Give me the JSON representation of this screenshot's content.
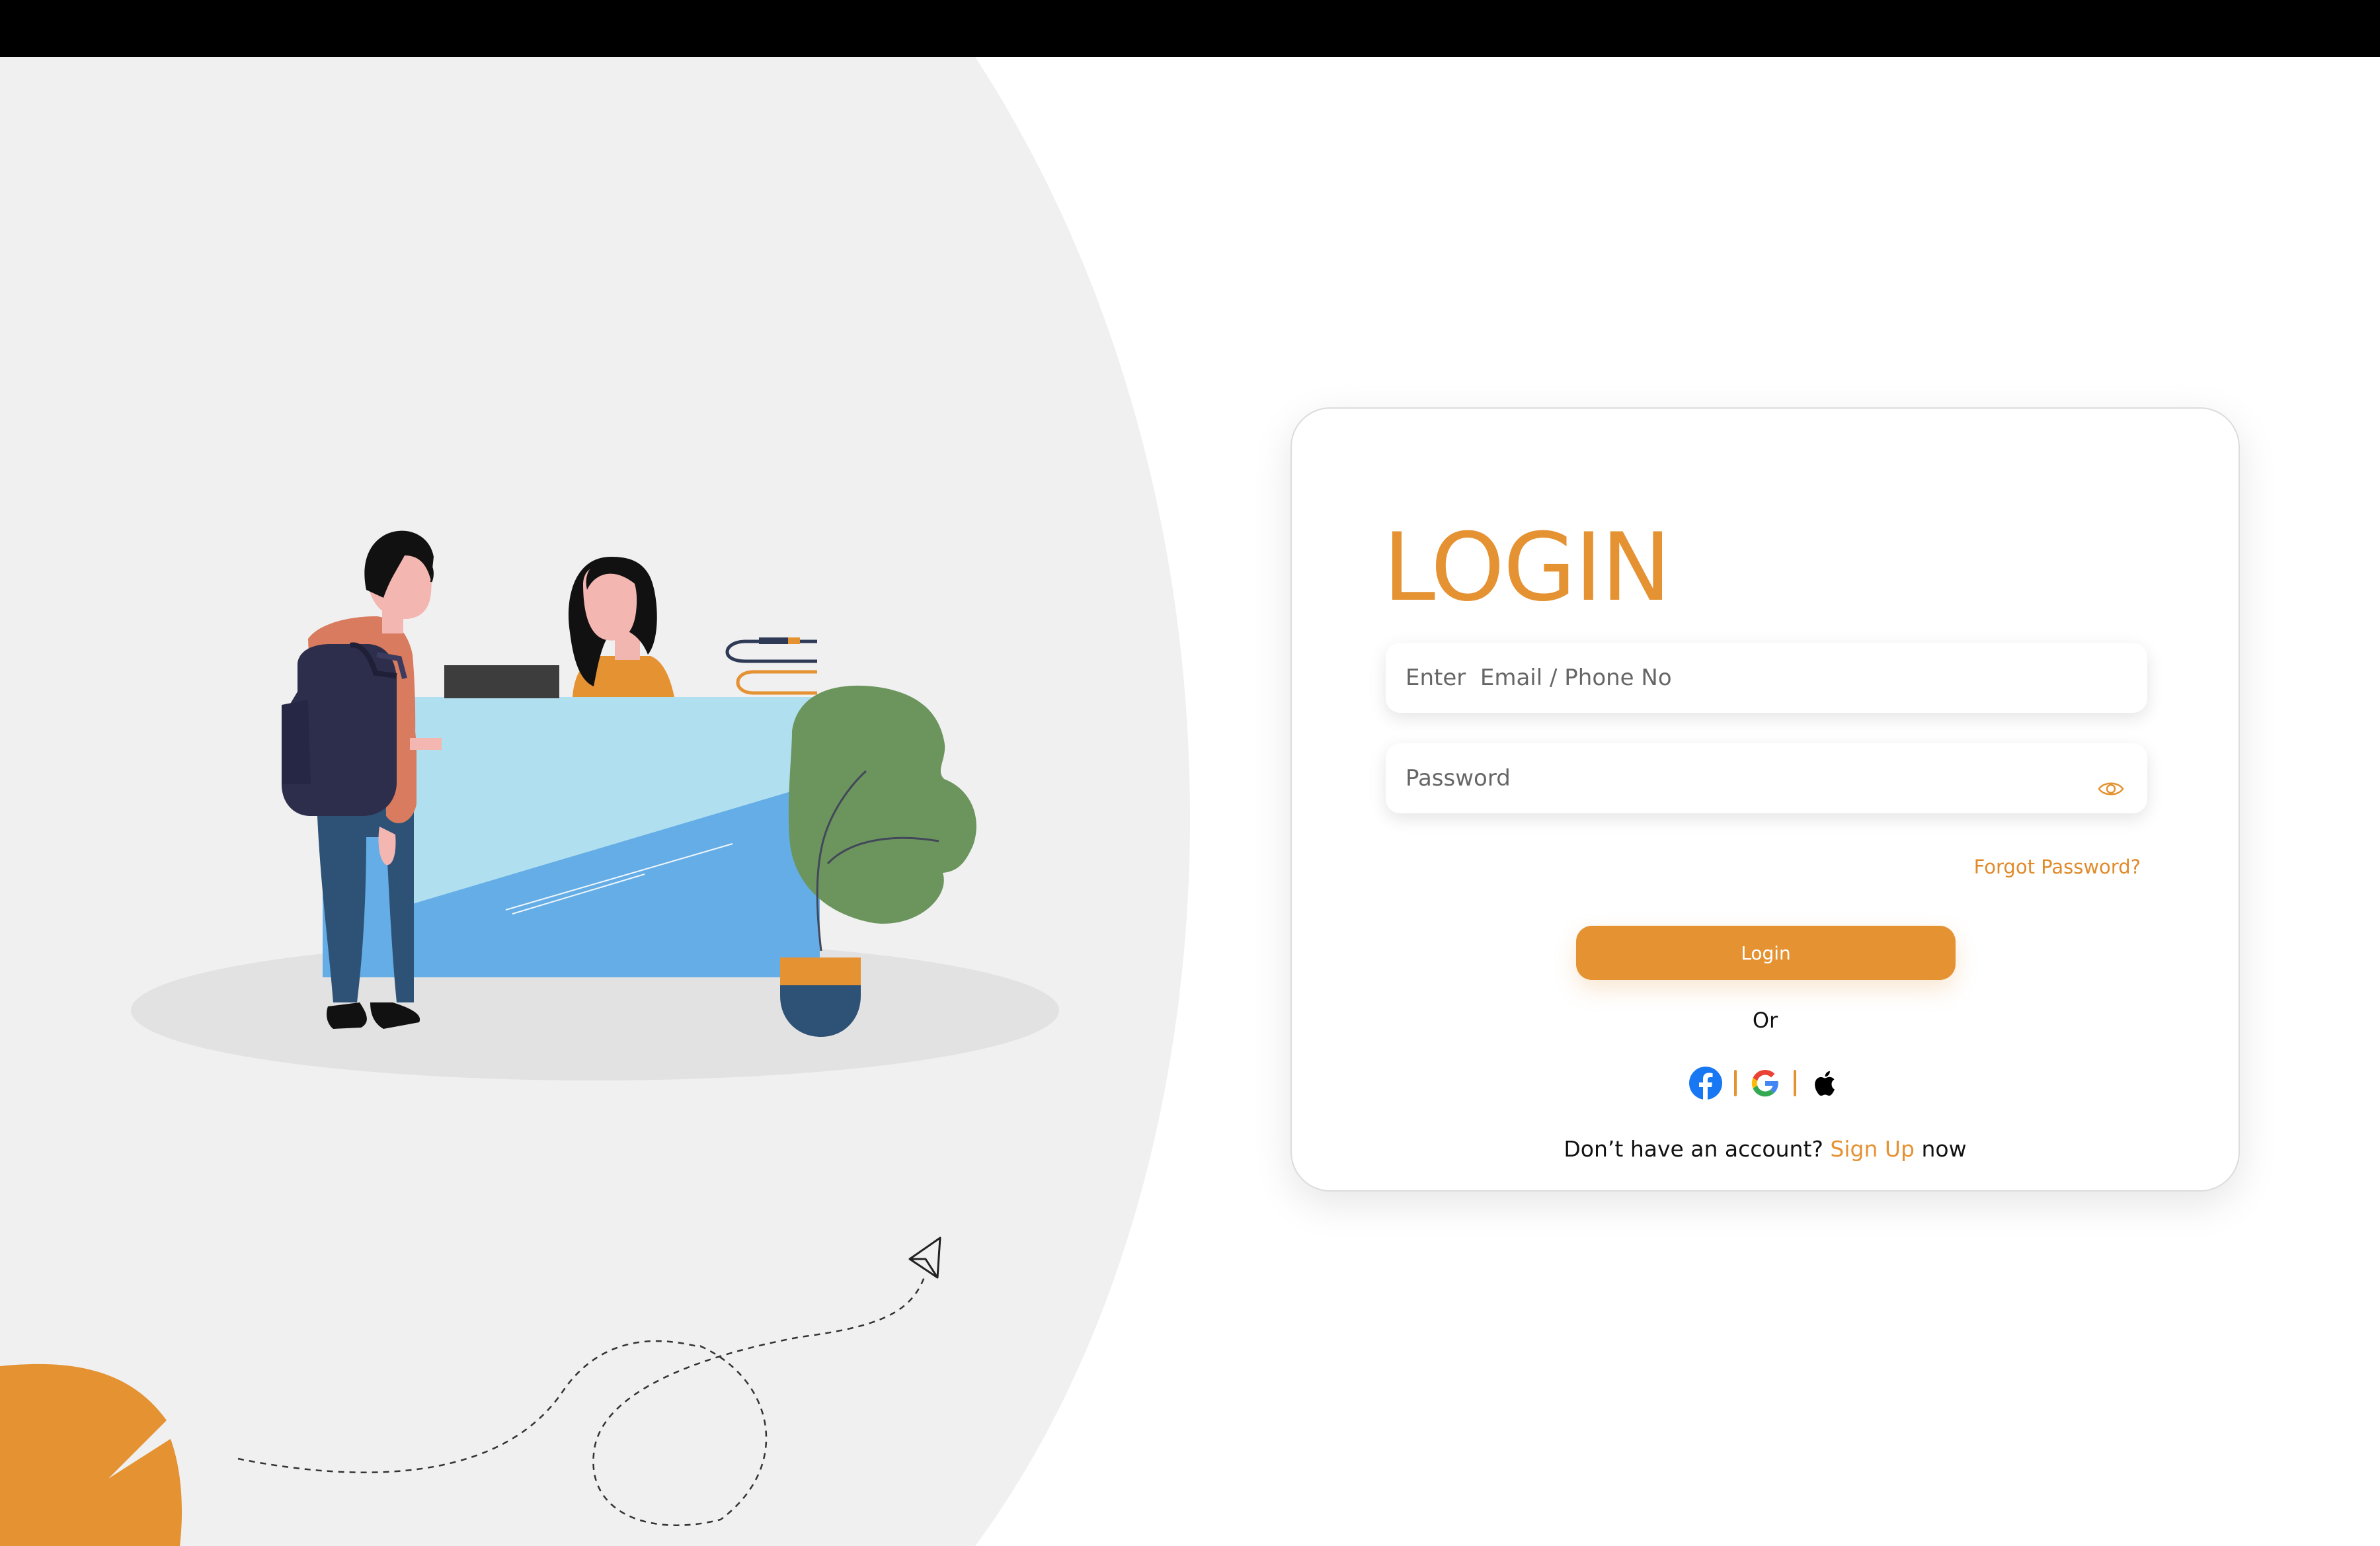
{
  "login_card": {
    "title": "LOGIN",
    "email_placeholder": "Enter  Email / Phone No",
    "password_placeholder": "Password",
    "forgot_password": "Forgot Password?",
    "login_button": "Login",
    "or_text": "Or",
    "social": [
      "facebook-icon",
      "google-icon",
      "apple-icon"
    ],
    "signup_prefix": "Don’t have an account?",
    "signup_link": "Sign Up",
    "signup_suffix": "now"
  },
  "colors": {
    "accent": "#e59233",
    "top_bar": "#000000",
    "backdrop": "#f0f0f0",
    "desk_light": "#b0dff0",
    "desk_dark": "#64ade6",
    "plant": "#6b955d",
    "pot": "#2e5276"
  }
}
